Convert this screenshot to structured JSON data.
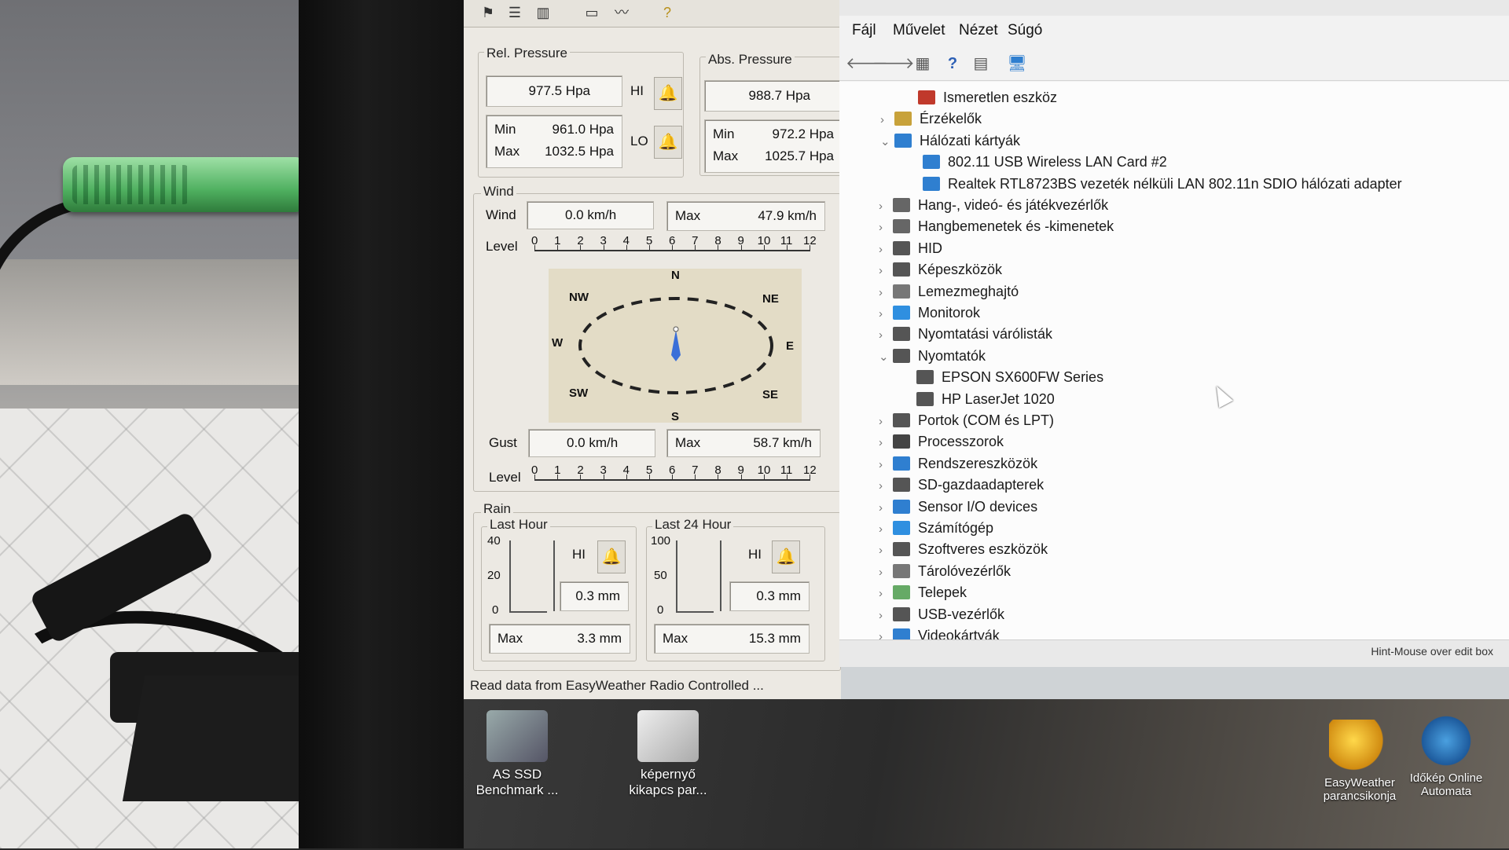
{
  "weather": {
    "rel_pressure": {
      "title": "Rel. Pressure",
      "current": "977.5 Hpa",
      "min_label": "Min",
      "min": "961.0 Hpa",
      "max_label": "Max",
      "max": "1032.5 Hpa",
      "hi": "HI",
      "lo": "LO"
    },
    "abs_pressure": {
      "title": "Abs. Pressure",
      "current": "988.7 Hpa",
      "min_label": "Min",
      "min": "972.2 Hpa",
      "max_label": "Max",
      "max": "1025.7 Hpa"
    },
    "wind": {
      "group_title": "Wind",
      "label": "Wind",
      "value": "0.0 km/h",
      "max_label": "Max",
      "max": "47.9 km/h",
      "level_label": "Level",
      "levels": [
        "0",
        "1",
        "2",
        "3",
        "4",
        "5",
        "6",
        "7",
        "8",
        "9",
        "10",
        "11",
        "12"
      ],
      "compass": {
        "n": "N",
        "ne": "NE",
        "e": "E",
        "se": "SE",
        "s": "S",
        "sw": "SW",
        "w": "W",
        "nw": "NW"
      },
      "gust_label": "Gust",
      "gust": "0.0 km/h",
      "gust_max_label": "Max",
      "gust_max": "58.7 km/h",
      "gust_level_label": "Level"
    },
    "rain": {
      "group_title": "Rain",
      "last_hour": {
        "title": "Last Hour",
        "axis": [
          "40",
          "20",
          "0"
        ],
        "hi": "HI",
        "value": "0.3 mm",
        "max_label": "Max",
        "max": "3.3 mm"
      },
      "last_24": {
        "title": "Last 24 Hour",
        "axis": [
          "100",
          "50",
          "0"
        ],
        "hi": "HI",
        "value": "0.3 mm",
        "max_label": "Max",
        "max": "15.3 mm"
      }
    },
    "status": "Read data from EasyWeather Radio Controlled ..."
  },
  "devmgr": {
    "menu": [
      "Fájl",
      "Művelet",
      "Nézet",
      "Súgó"
    ],
    "tree": [
      {
        "label": "Ismeretlen eszköz",
        "chev": "",
        "color": "#c0392b"
      },
      {
        "label": "Érzékelők",
        "chev": "›",
        "color": "#c8a23a"
      },
      {
        "label": "Hálózati kártyák",
        "chev": "⌄",
        "color": "#2f7fd0"
      },
      {
        "label": "802.11 USB Wireless LAN Card #2",
        "chev": "",
        "color": "#2f7fd0"
      },
      {
        "label": "Realtek RTL8723BS vezeték nélküli LAN 802.11n SDIO hálózati adapter",
        "chev": "",
        "color": "#2f7fd0"
      },
      {
        "label": "Hang-, videó- és játékvezérlők",
        "chev": "›",
        "color": "#666"
      },
      {
        "label": "Hangbemenetek és -kimenetek",
        "chev": "›",
        "color": "#666"
      },
      {
        "label": "HID",
        "chev": "›",
        "color": "#555"
      },
      {
        "label": "Képeszközök",
        "chev": "›",
        "color": "#555"
      },
      {
        "label": "Lemezmeghajtó",
        "chev": "›",
        "color": "#777"
      },
      {
        "label": "Monitorok",
        "chev": "›",
        "color": "#2f8fe0"
      },
      {
        "label": "Nyomtatási várólisták",
        "chev": "›",
        "color": "#555"
      },
      {
        "label": "Nyomtatók",
        "chev": "⌄",
        "color": "#555"
      },
      {
        "label": "EPSON SX600FW Series",
        "chev": "",
        "color": "#555"
      },
      {
        "label": "HP LaserJet 1020",
        "chev": "",
        "color": "#555"
      },
      {
        "label": "Portok (COM és LPT)",
        "chev": "›",
        "color": "#555"
      },
      {
        "label": "Processzorok",
        "chev": "›",
        "color": "#444"
      },
      {
        "label": "Rendszereszközök",
        "chev": "›",
        "color": "#2f7fd0"
      },
      {
        "label": "SD-gazdaadapterek",
        "chev": "›",
        "color": "#555"
      },
      {
        "label": "Sensor I/O devices",
        "chev": "›",
        "color": "#2f7fd0"
      },
      {
        "label": "Számítógép",
        "chev": "›",
        "color": "#2f8fe0"
      },
      {
        "label": "Szoftveres eszközök",
        "chev": "›",
        "color": "#555"
      },
      {
        "label": "Tárolóvezérlők",
        "chev": "›",
        "color": "#777"
      },
      {
        "label": "Telepek",
        "chev": "›",
        "color": "#6a6"
      },
      {
        "label": "USB-vezérlők",
        "chev": "›",
        "color": "#555"
      },
      {
        "label": "Videokártyák",
        "chev": "›",
        "color": "#2f7fd0"
      }
    ],
    "hint": "Hint-Mouse over edit box"
  },
  "desktop": {
    "icons": [
      {
        "line1": "AS SSD",
        "line2": "Benchmark ..."
      },
      {
        "line1": "képernyő",
        "line2": "kikapcs par..."
      },
      {
        "line1": "EasyWeather",
        "line2": "parancsikonja"
      },
      {
        "line1": "Időkép Online",
        "line2": "Automata"
      }
    ]
  }
}
